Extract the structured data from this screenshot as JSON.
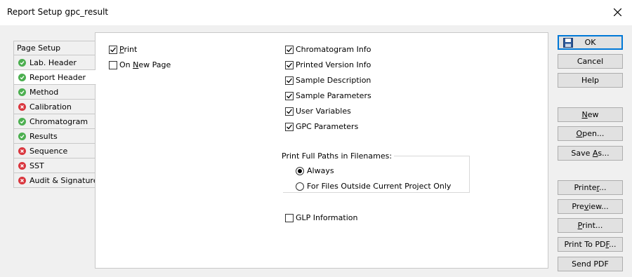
{
  "window": {
    "title": "Report Setup gpc_result"
  },
  "tabs": [
    {
      "label": "Page Setup",
      "status": "none"
    },
    {
      "label": "Lab. Header",
      "status": "ok"
    },
    {
      "label": "Report Header",
      "status": "ok"
    },
    {
      "label": "Method",
      "status": "ok"
    },
    {
      "label": "Calibration",
      "status": "error"
    },
    {
      "label": "Chromatogram",
      "status": "ok"
    },
    {
      "label": "Results",
      "status": "ok"
    },
    {
      "label": "Sequence",
      "status": "error"
    },
    {
      "label": "SST",
      "status": "error"
    },
    {
      "label": "Audit & Signatures",
      "status": "error"
    }
  ],
  "active_tab": "Report Header",
  "left_options": {
    "print": {
      "label_pre": "",
      "label_key": "P",
      "label_post": "rint",
      "checked": true
    },
    "new_page": {
      "label_pre": "On ",
      "label_key": "N",
      "label_post": "ew Page",
      "checked": false
    }
  },
  "right_options": [
    {
      "label": "Chromatogram Info",
      "checked": true
    },
    {
      "label": "Printed Version Info",
      "checked": true
    },
    {
      "label": "Sample Description",
      "checked": true
    },
    {
      "label": "Sample Parameters",
      "checked": true
    },
    {
      "label": "User Variables",
      "checked": true
    },
    {
      "label": "GPC Parameters",
      "checked": true
    }
  ],
  "paths_group": {
    "label": "Print Full Paths in Filenames:",
    "options": [
      {
        "label": "Always",
        "selected": true
      },
      {
        "label": "For Files Outside Current Project Only",
        "selected": false
      }
    ]
  },
  "glp": {
    "label": "GLP Information",
    "checked": false
  },
  "buttons": {
    "ok": "OK",
    "cancel": "Cancel",
    "help": "Help",
    "new": {
      "pre": "",
      "key": "N",
      "post": "ew"
    },
    "open": {
      "pre": "",
      "key": "O",
      "post": "pen..."
    },
    "save_as": {
      "pre": "Save ",
      "key": "A",
      "post": "s..."
    },
    "printer": {
      "pre": "Printe",
      "key": "r",
      "post": "..."
    },
    "preview": {
      "pre": "Pre",
      "key": "v",
      "post": "iew..."
    },
    "print": {
      "pre": "",
      "key": "P",
      "post": "rint..."
    },
    "print_pdf": {
      "pre": "Print To PD",
      "key": "F",
      "post": "..."
    },
    "send_pdf": "Send PDF"
  },
  "colors": {
    "ok": "#4caf50",
    "error": "#d9363e",
    "default_button_border": "#0078d7"
  }
}
